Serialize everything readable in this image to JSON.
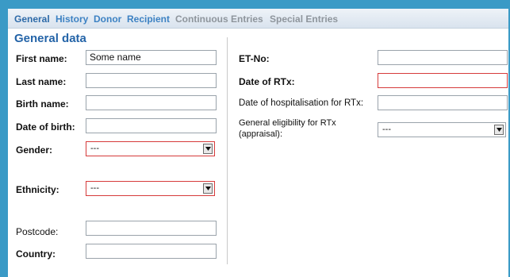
{
  "tabs": [
    {
      "label": "General"
    },
    {
      "label": "History"
    },
    {
      "label": "Donor"
    },
    {
      "label": "Recipient"
    },
    {
      "label": "Continuous Entries"
    },
    {
      "label": "Special Entries"
    }
  ],
  "section_title": "General data",
  "left": {
    "first_name": {
      "label": "First name:",
      "value": "Some name"
    },
    "last_name": {
      "label": "Last name:",
      "value": ""
    },
    "birth_name": {
      "label": "Birth name:",
      "value": ""
    },
    "date_of_birth": {
      "label": "Date of birth:",
      "value": ""
    },
    "gender": {
      "label": "Gender:",
      "value": "---"
    },
    "ethnicity": {
      "label": "Ethnicity:",
      "value": "---"
    },
    "postcode": {
      "label": "Postcode:",
      "value": ""
    },
    "country": {
      "label": "Country:",
      "value": ""
    }
  },
  "right": {
    "et_no": {
      "label": "ET-No:",
      "value": ""
    },
    "date_rtx": {
      "label": "Date of RTx:",
      "value": ""
    },
    "date_hosp": {
      "label": "Date of hospitalisation for RTx:",
      "value": ""
    },
    "eligibility": {
      "label": "General eligibility for RTx (appraisal):",
      "value": "---"
    }
  },
  "colors": {
    "background": "#3a9ac6",
    "tab_active": "#2d6aa8",
    "tab_link": "#3d82c3",
    "tab_muted": "#8e959c",
    "error_border": "#d63b3b"
  },
  "icons": {
    "select_arrow": "chevron-down-icon"
  }
}
